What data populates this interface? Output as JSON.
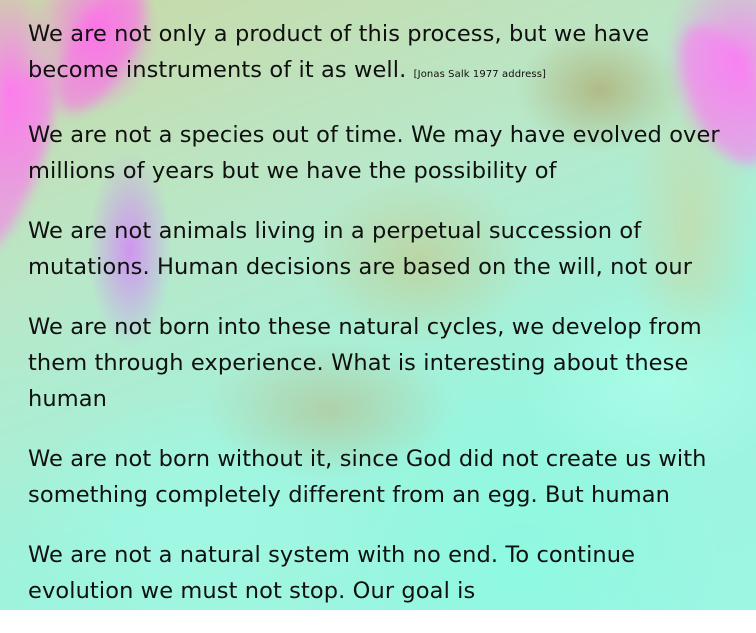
{
  "paragraphs": [
    {
      "text": "We are not only a product of this process, but we have become instruments of it as well.",
      "citation": "[Jonas Salk 1977 address]"
    },
    {
      "text": "We are not a species out of time. We may have evolved over millions of years but we have the possibility of"
    },
    {
      "text": "We are not animals living in a perpetual succession of mutations. Human decisions are based on the will, not our"
    },
    {
      "text": "We are not born into these natural cycles, we develop from them through experience. What is interesting about these human"
    },
    {
      "text": "We are not born without it, since God did not create us with something completely different from an egg. But human"
    },
    {
      "text": "We are not a natural system with no end. To continue evolution we must not stop. Our goal is"
    }
  ],
  "colors": {
    "text": "#101010",
    "background_primary": "#9ff3dd",
    "background_accent_pink": "#ff78f0",
    "background_accent_olive": "#c9d8a6"
  }
}
